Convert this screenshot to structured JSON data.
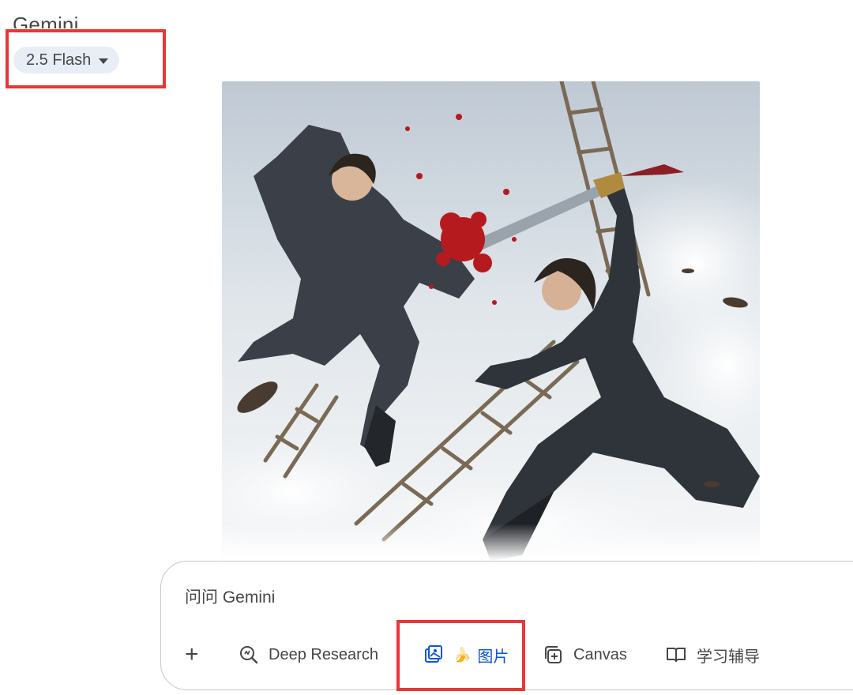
{
  "header": {
    "title": "Gemini",
    "model_label": "2.5 Flash"
  },
  "composer": {
    "placeholder": "问问 Gemini",
    "tools": {
      "add_label": "+",
      "deep_research": "Deep Research",
      "image_emoji": "🍌",
      "image": "图片",
      "canvas": "Canvas",
      "study": "学习辅导"
    }
  },
  "colors": {
    "highlight": "#e53935",
    "chip_bg": "#e9eef6",
    "active_tool": "#0b57d0",
    "text": "#444746"
  }
}
